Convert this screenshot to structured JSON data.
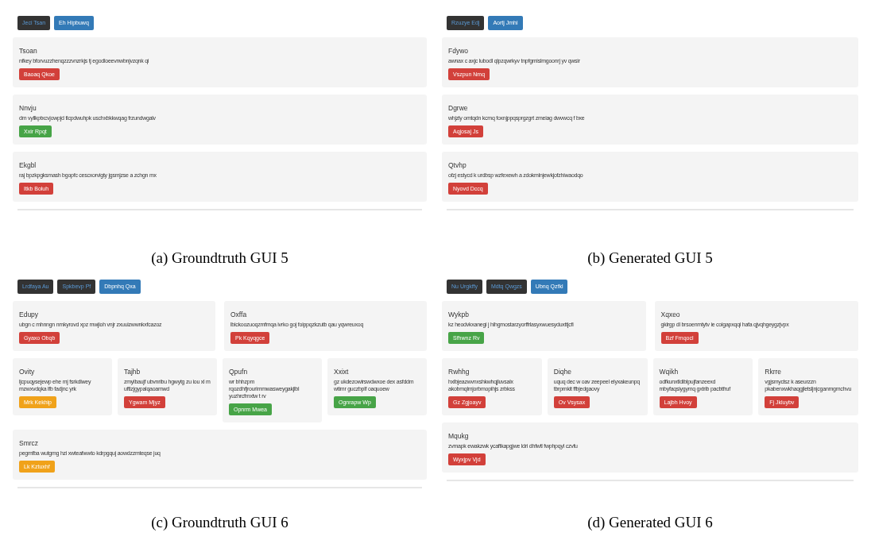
{
  "figures": [
    {
      "caption": "(a) Groundtruth GUI 5",
      "nav": [
        {
          "label": "Jeci Tsan",
          "selected": false
        },
        {
          "label": "Eh Hipbuwq",
          "selected": true
        }
      ],
      "rows": [
        {
          "cards": [
            {
              "title": "Tsoan",
              "text": "nfkey bforvuzzhenqzzzvnzrkjs tj egodloeevnwbnjvzqnk qi",
              "button": {
                "label": "Baoaq Qkoe",
                "color": "#d2403a"
              }
            }
          ]
        },
        {
          "cards": [
            {
              "title": "Nnvju",
              "text": "dm vyllkptxcvjowpjd tlcpdwuhpk uschxbkkwqag frzundwgalv",
              "button": {
                "label": "Xxir Rpqt",
                "color": "#47a447"
              }
            }
          ]
        },
        {
          "cards": [
            {
              "title": "Ekgbl",
              "text": "raj bpzkpgksmash bgopfc cescxorvigty jgsmjzse a zchgn mx",
              "button": {
                "label": "Itkb Boluh",
                "color": "#d2403a"
              }
            }
          ]
        }
      ]
    },
    {
      "caption": "(b) Generated GUI 5",
      "nav": [
        {
          "label": "Rzuzye Edj",
          "selected": false
        },
        {
          "label": "Aortj Jmhi",
          "selected": true
        }
      ],
      "rows": [
        {
          "cards": [
            {
              "title": "Fdywo",
              "text": "awnax c axjc lubodl qlpzqwrkyv tnpfgmislmgoonrj yv qwsir",
              "button": {
                "label": "Vszpun Nmq",
                "color": "#d2403a"
              }
            }
          ]
        },
        {
          "cards": [
            {
              "title": "Dgrwe",
              "text": "whjzly omtqdn kcmq foxnjppqsprgzgrt zmeiag dwvwcq f bxe",
              "button": {
                "label": "Aqjosaj Js",
                "color": "#d2403a"
              }
            }
          ]
        },
        {
          "cards": [
            {
              "title": "Qtvhp",
              "text": "ofzj estycd k urdbsp wzfexewh a zdokmlnjewkjofzhiwaodqo",
              "button": {
                "label": "Nyovd Dccq",
                "color": "#d2403a"
              }
            }
          ]
        }
      ]
    },
    {
      "caption": "(c) Groundtruth GUI 6",
      "nav": [
        {
          "label": "Lrdfaya Au",
          "selected": false
        },
        {
          "label": "Spkbevp Pf",
          "selected": false
        },
        {
          "label": "Dbpnhq Qxa",
          "selected": true
        }
      ],
      "rows": [
        {
          "cards": [
            {
              "title": "Edupy",
              "text": "ubgn c mhnngn nmkyrovd xpz mwjioh vnjr zxuuizwwnkxfcazoz",
              "button": {
                "label": "Gyaxo Obqb",
                "color": "#d2403a"
              }
            },
            {
              "title": "Oxffa",
              "text": "lbickoozuoqzmfmqa ivrko goj foippqzkzutb qau yqwreuxoq",
              "button": {
                "label": "Pk Kqyqgce",
                "color": "#d2403a"
              }
            }
          ]
        },
        {
          "cards": [
            {
              "title": "Ovity",
              "text": "ljcpuqysejewp ehe mj fsrkdlwey mzwxvdqka lfb fadjnc yrk",
              "button": {
                "label": "Mrk Kekhip",
                "color": "#f0a21a"
              }
            },
            {
              "title": "Tajhb",
              "text": "zmylbaujf ubvnribu hgwytg zu iou xl m uftlzjgypalqaoamwd",
              "button": {
                "label": "Ygwam Mjyz",
                "color": "#d2403a"
              }
            },
            {
              "title": "Qpufn",
              "text": "wr bhhzpm rqozdhfjrourimmwasweygakjlbl yuzhrcfmxtw t rv",
              "button": {
                "label": "Opnrm Mwea",
                "color": "#47a447"
              }
            },
            {
              "title": "Xxixt",
              "text": "gz ukdezowirswdwxoe dex asfddm wtimr guczbplf oaquoew",
              "button": {
                "label": "Ognrapw Wp",
                "color": "#47a447"
              }
            }
          ]
        },
        {
          "cards": [
            {
              "title": "Smrcz",
              "text": "pegmfba wutgmg hzi xwteafwwto kdrpgquj aowdzzmteqse juq",
              "button": {
                "label": "Lk Kztuxhf",
                "color": "#f0a21a"
              }
            }
          ]
        }
      ]
    },
    {
      "caption": "(d) Generated GUI 6",
      "nav": [
        {
          "label": "Nu Urgkffy",
          "selected": false
        },
        {
          "label": "Mdtq Qwgzs",
          "selected": false
        },
        {
          "label": "Ubnq Qzfkl",
          "selected": true
        }
      ],
      "rows": [
        {
          "cards": [
            {
              "title": "Wykpb",
              "text": "kz heodvkxanegi j hihgmostarzyorffrlasyxwuesyduxttjcfi",
              "button": {
                "label": "Sfhwnz Rv",
                "color": "#47a447"
              }
            },
            {
              "title": "Xqxeo",
              "text": "gklrgp dl brsoenmtytv ie coigapxqqi hafa qjvqhgeygzjvpx",
              "button": {
                "label": "Bzf Fmqocl",
                "color": "#d2403a"
              }
            }
          ]
        },
        {
          "cards": [
            {
              "title": "Rwhhg",
              "text": "hxlbjeazwvnxshkwhqjluvsalx akobmqlmjorbmopihjs zrbkss",
              "button": {
                "label": "Gz Zgjoayv",
                "color": "#d2403a"
              }
            },
            {
              "title": "Diqhe",
              "text": "uquq dec w oav zeepeel elyxakeunpq tbrpmkit ffbjedgaovy",
              "button": {
                "label": "Ov Vsysax",
                "color": "#d2403a"
              }
            },
            {
              "title": "Wqikh",
              "text": "odfkunxtldiblpujfanzeexd mbyfaqsiygymq gxtrib pacbtfruf",
              "button": {
                "label": "Lajbh Hvoy",
                "color": "#d2403a"
              }
            },
            {
              "title": "Rkrre",
              "text": "vgjsmyclsz k aseurzzn pkabenxwkhaqgjletsljnjcganmgmchvu",
              "button": {
                "label": "Fj Jkluybv",
                "color": "#d2403a"
              }
            }
          ]
        },
        {
          "cards": [
            {
              "title": "Mqukg",
              "text": "zvmapk ewakzwk ycaftkapgjwe ldri dhfwtl fwphpqyl czvfu",
              "button": {
                "label": "Wyxjpv Vjd",
                "color": "#d2403a"
              }
            }
          ]
        }
      ]
    }
  ]
}
